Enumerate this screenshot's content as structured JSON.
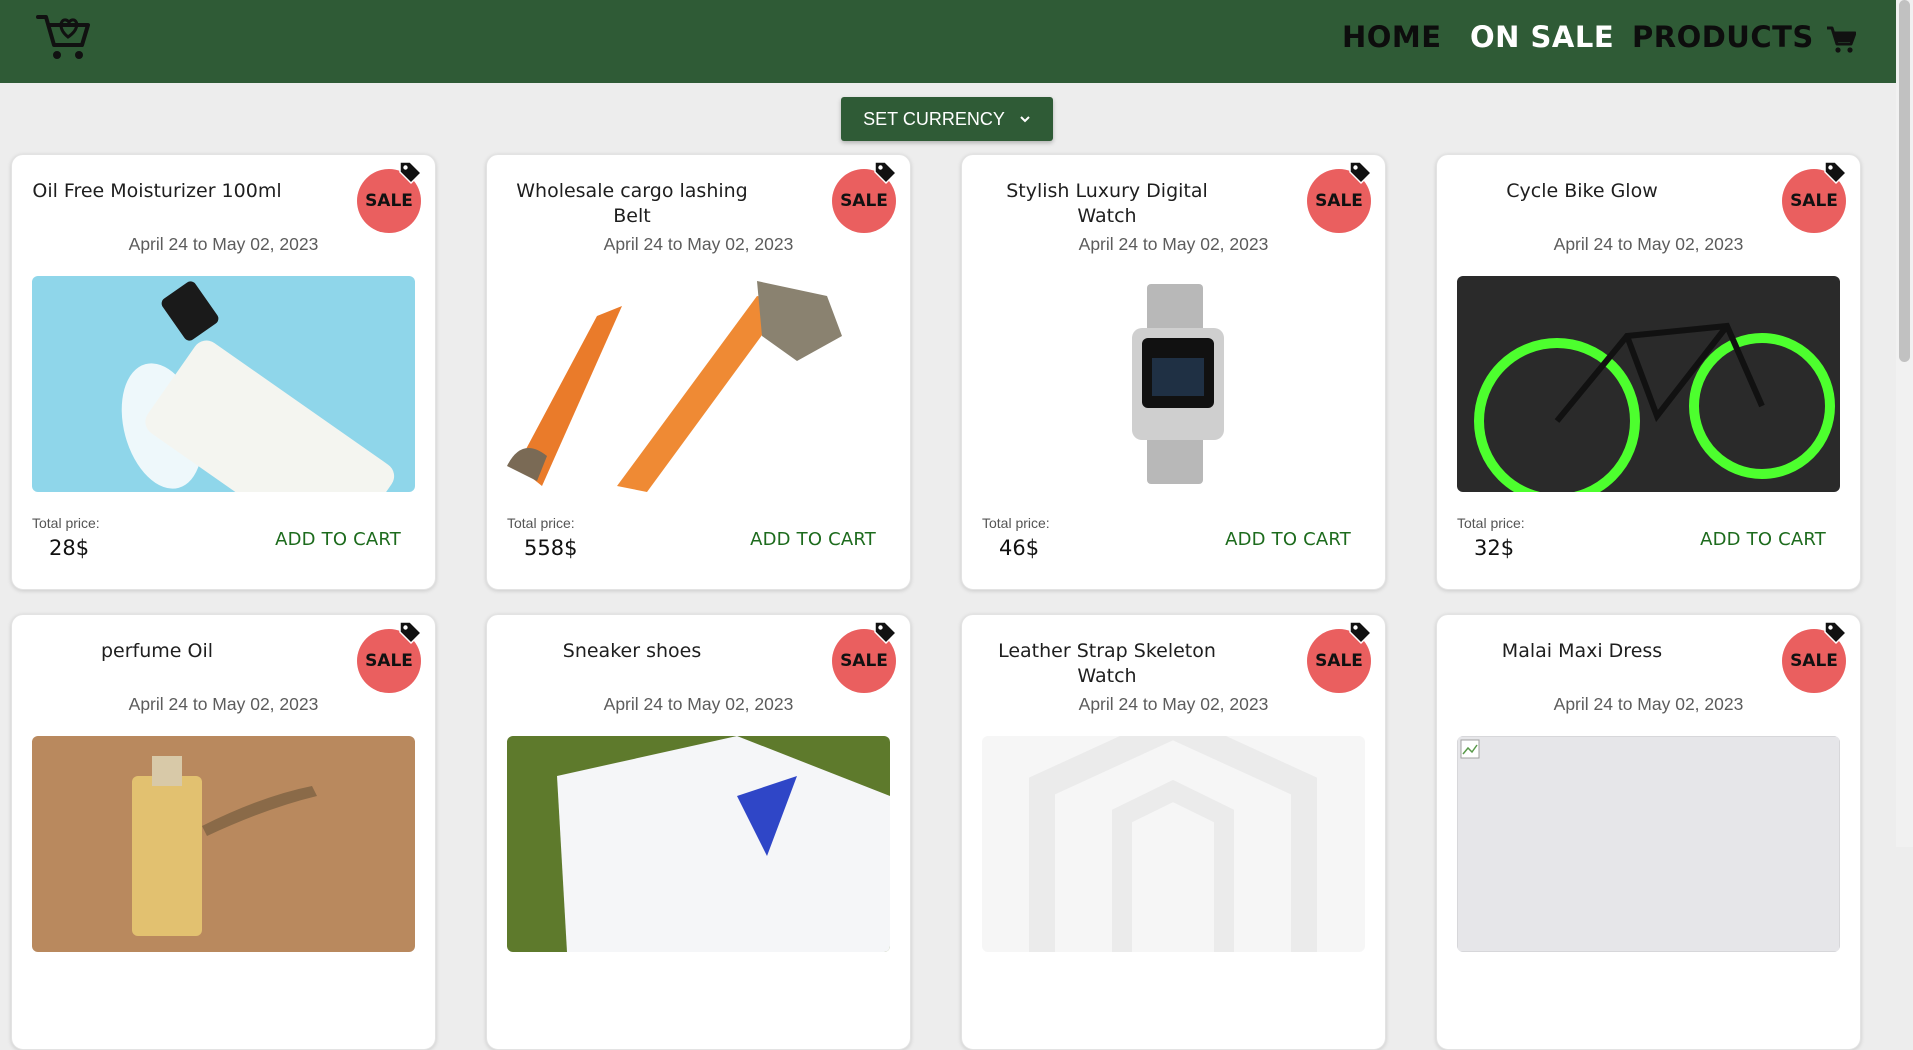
{
  "nav": {
    "home": "HOME",
    "on_sale": "ON SALE",
    "products": "PRODUCTS"
  },
  "currency": {
    "label": "SET CURRENCY"
  },
  "products": [
    {
      "title": "Oil Free Moisturizer 100ml",
      "badge": "SALE",
      "dates": "April 24 to May 02, 2023",
      "price_label": "Total price:",
      "price": "28$",
      "cta": "ADD TO CART"
    },
    {
      "title": "Wholesale cargo lashing Belt",
      "badge": "SALE",
      "dates": "April 24 to May 02, 2023",
      "price_label": "Total price:",
      "price": "558$",
      "cta": "ADD TO CART"
    },
    {
      "title": "Stylish Luxury Digital Watch",
      "badge": "SALE",
      "dates": "April 24 to May 02, 2023",
      "price_label": "Total price:",
      "price": "46$",
      "cta": "ADD TO CART"
    },
    {
      "title": "Cycle Bike Glow",
      "badge": "SALE",
      "dates": "April 24 to May 02, 2023",
      "price_label": "Total price:",
      "price": "32$",
      "cta": "ADD TO CART"
    },
    {
      "title": "perfume Oil",
      "badge": "SALE",
      "dates": "April 24 to May 02, 2023"
    },
    {
      "title": "Sneaker shoes",
      "badge": "SALE",
      "dates": "April 24 to May 02, 2023"
    },
    {
      "title": "Leather Strap Skeleton Watch",
      "badge": "SALE",
      "dates": "April 24 to May 02, 2023"
    },
    {
      "title": "Malai Maxi Dress",
      "badge": "SALE",
      "dates": "April 24 to May 02, 2023"
    }
  ],
  "colors": {
    "header": "#2f5b36",
    "sale_badge": "#ea5f5f",
    "add_to_cart": "#1d6b1d"
  }
}
